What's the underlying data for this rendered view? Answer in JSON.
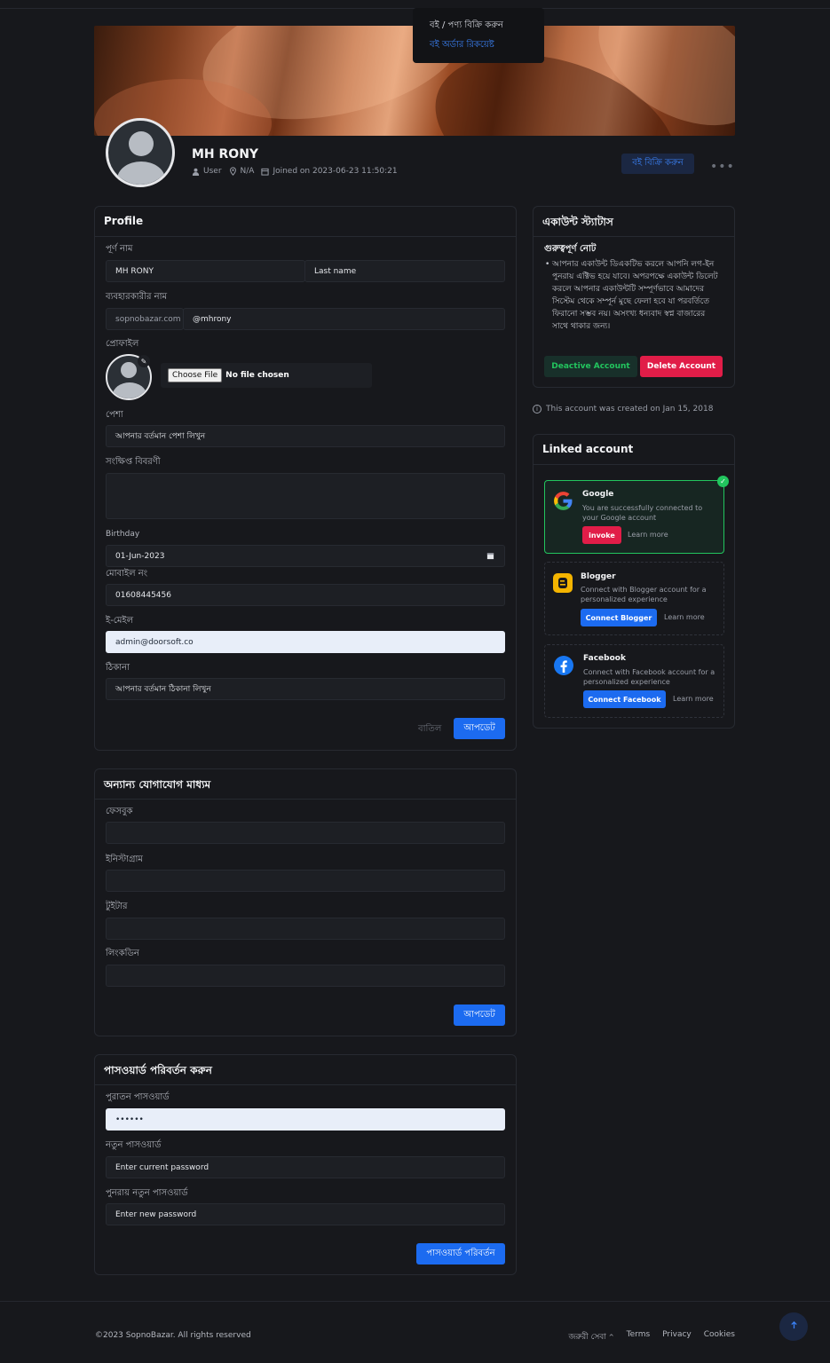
{
  "popup_menu": {
    "item_sell": "বই / পণ্য বিক্রি করুন",
    "item_order": "বই অর্ডার রিকয়েষ্ট"
  },
  "header": {
    "name": "MH RONY",
    "role": "User",
    "location": "N/A",
    "joined": "Joined on 2023-06-23 11:50:21",
    "sell_button": "বই বিক্রি করুন",
    "more": "•••"
  },
  "profile_form": {
    "title": "Profile",
    "fullname_label": "পূর্ণ নাম",
    "first_name_value": "MH RONY",
    "last_name_placeholder": "Last name",
    "username_label": "ব্যবহারকারীর নাম",
    "username_prefix": "sopnobazar.com",
    "username_value": "@mhrony",
    "photo_label": "প্রোফাইল",
    "choose_file": "Choose File",
    "no_file": "No file chosen",
    "profession_label": "পেশা",
    "profession_placeholder": "আপনার বর্তমান পেশা লিখুন",
    "bio_label": "সংক্ষিপ্ত বিবরণী",
    "birthday_label": "Birthday",
    "birthday_value": "01-Jun-2023",
    "mobile_label": "মোবাইল নং",
    "mobile_value": "01608445456",
    "email_label": "ই-মেইল",
    "email_value": "admin@doorsoft.co",
    "address_label": "ঠিকানা",
    "address_placeholder": "আপনার বর্তমান ঠিকানা লিখুন",
    "cancel": "বাতিল",
    "update": "আপডেট"
  },
  "social_form": {
    "title": "অন্যান্য যোগাযোগ মাধ্যম",
    "facebook_label": "ফেসবুক",
    "instagram_label": "ইনিস্টাগ্রাম",
    "twitter_label": "টুইটার",
    "linkedin_label": "লিংকডিন",
    "update": "আপডেট"
  },
  "password_form": {
    "title": "পাসওয়ার্ড পরিবর্তন করুন",
    "old_label": "পুরাতন পাসওয়ার্ড",
    "old_value": "••••••",
    "new_label": "নতুন পাসওয়ার্ড",
    "new_placeholder": "Enter current password",
    "confirm_label": "পুনরায় নতুন পাসওয়ার্ড",
    "confirm_placeholder": "Enter new password",
    "submit": "পাসওয়ার্ড পরিবর্তন"
  },
  "account_status": {
    "title": "একাউন্ট স্ট্যাটাস",
    "note_title": "গুরুত্বপূর্ণ নোট",
    "note_text": "আপনার একাউন্ট ডিএকটিভ করলে আপনি লগ-ইন পুনরায় এক্টিভ হয়ে যাবে। অপরপক্ষে একাউন্ট ডিলেট করলে আপনার একাউন্টটি সম্পূর্ণভাবে আমাদের সিস্টেম থেকে সম্পূর্ন মুছে ফেলা হবে যা পরবর্তিতে ফিরানো সম্ভব নয়। অসংখ্য ধন্যবাদ স্বপ্ন বাজারের সাথে থাকার জন্য।",
    "deactivate": "Deactive Account",
    "delete": "Delete Account",
    "created_note": "This account was created on Jan 15, 2018"
  },
  "linked": {
    "title": "Linked account",
    "google": {
      "name": "Google",
      "desc": "You are successfully connected to your Google account",
      "btn": "invoke",
      "learn": "Learn more"
    },
    "blogger": {
      "name": "Blogger",
      "desc": "Connect with Blogger account for a personalized experience",
      "btn": "Connect Blogger",
      "learn": "Learn more"
    },
    "facebook": {
      "name": "Facebook",
      "desc": "Connect with Facebook account for a personalized experience",
      "btn": "Connect Facebook",
      "learn": "Learn more"
    }
  },
  "footer": {
    "copyright": "©2023 SopnoBazar. All rights reserved",
    "emergency": "জরুরী সেবা",
    "terms": "Terms",
    "privacy": "Privacy",
    "cookies": "Cookies"
  },
  "colors": {
    "primary": "#1c6bf0",
    "danger": "#e11d48",
    "success": "#22c55e",
    "background": "#17181c"
  }
}
